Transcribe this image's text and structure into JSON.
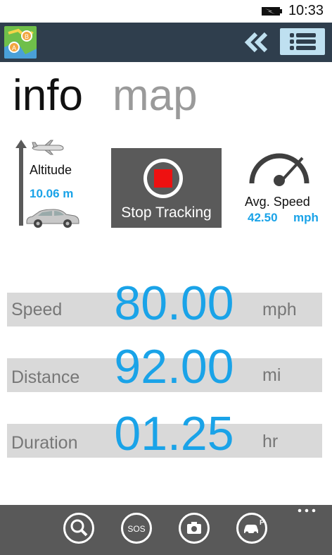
{
  "status": {
    "time": "10:33"
  },
  "pivot": {
    "info": "info",
    "map": "map"
  },
  "altitude": {
    "label": "Altitude",
    "value": "10.06 m"
  },
  "tracking": {
    "button_label": "Stop Tracking"
  },
  "avg_speed": {
    "label": "Avg. Speed",
    "value": "42.50",
    "unit": "mph"
  },
  "metrics": [
    {
      "label": "Speed",
      "value": "80.00",
      "unit": "mph"
    },
    {
      "label": "Distance",
      "value": "92.00",
      "unit": "mi"
    },
    {
      "label": "Duration",
      "value": "01.25",
      "unit": "hr"
    }
  ],
  "appbar": {
    "icons": [
      "search-icon",
      "sos-icon",
      "camera-icon",
      "parking-car-icon"
    ],
    "sos_text": "SOS"
  },
  "colors": {
    "accent": "#1aa3e8",
    "header": "#2f3e4d",
    "stop_red": "#ee1111",
    "appbar": "#595959"
  }
}
